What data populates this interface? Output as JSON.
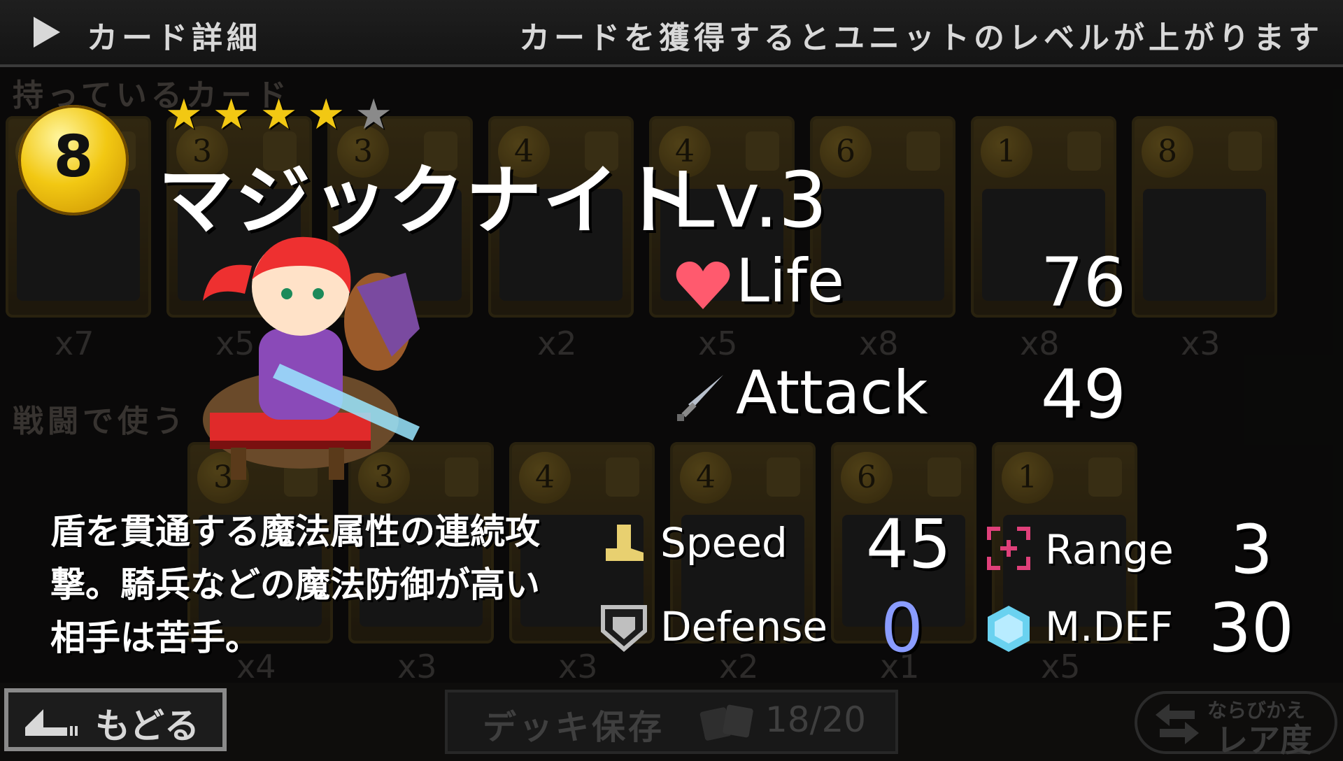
{
  "header": {
    "title": "カード詳細",
    "hint": "カードを獲得するとユニットのレベルが上がります"
  },
  "background": {
    "owned_label": "持っているカード",
    "owned_cards": [
      {
        "cost": "",
        "count": "x7"
      },
      {
        "cost": "3",
        "count": "x5"
      },
      {
        "cost": "3",
        "count": ""
      },
      {
        "cost": "4",
        "count": "x2"
      },
      {
        "cost": "4",
        "count": "x5"
      },
      {
        "cost": "6",
        "count": "x8"
      },
      {
        "cost": "1",
        "count": "x8"
      },
      {
        "cost": "8",
        "count": "x3"
      }
    ],
    "battle_label": "戦闘で使う",
    "battle_cards": [
      {
        "cost": "3",
        "count": "x4"
      },
      {
        "cost": "3",
        "count": "x3"
      },
      {
        "cost": "4",
        "count": "x3"
      },
      {
        "cost": "4",
        "count": "x2"
      },
      {
        "cost": "6",
        "count": "x1"
      },
      {
        "cost": "1",
        "count": "x5"
      }
    ]
  },
  "unit": {
    "rank": "8",
    "stars_filled": 4,
    "stars_total": 5,
    "name": "マジックナイト",
    "level": "Lv.3",
    "description": [
      "盾を貫通する魔法属性の連続攻",
      "撃。騎兵などの魔法防御が高い",
      "相手は苦手。"
    ]
  },
  "stats": {
    "life": {
      "label": "Life",
      "value": "76",
      "icon": "heart-icon"
    },
    "attack": {
      "label": "Attack",
      "value": "49",
      "icon": "sword-icon"
    },
    "speed": {
      "label": "Speed",
      "value": "45",
      "icon": "boot-icon"
    },
    "range": {
      "label": "Range",
      "value": "3",
      "icon": "crosshair-icon"
    },
    "defense": {
      "label": "Defense",
      "value": "0",
      "icon": "shield-icon",
      "color": "#8a9cff"
    },
    "mdef": {
      "label": "M.DEF",
      "value": "30",
      "icon": "hexagon-icon"
    }
  },
  "footer": {
    "back": "もどる",
    "save": "デッキ保存",
    "deck_count": "18/20",
    "sort_small": "ならびかえ",
    "sort_big": "レア度"
  },
  "colors": {
    "gold": "#f2c813",
    "heart": "#ff5a6e",
    "crosshair": "#e0407a",
    "hexagon": "#6ad2f0"
  }
}
